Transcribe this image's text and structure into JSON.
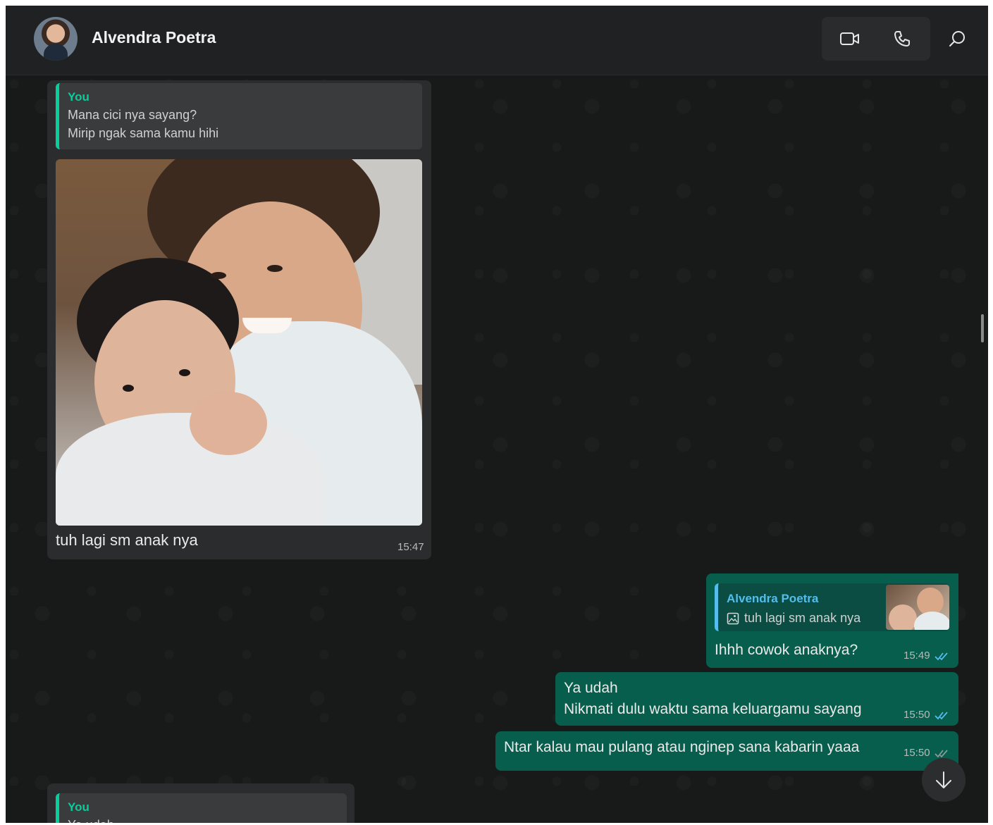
{
  "header": {
    "contact_name": "Alvendra Poetra",
    "icons": {
      "avatar": "contact-avatar",
      "video": "video-call-icon",
      "voice": "voice-call-icon",
      "search": "search-icon"
    }
  },
  "messages": {
    "m1": {
      "quote_author": "You",
      "quote_line1": "Mana cici nya sayang?",
      "quote_line2": "Mirip ngak sama kamu hihi",
      "caption": "tuh lagi sm anak nya",
      "time": "15:47",
      "attachment": "photo-woman-with-baby"
    },
    "m2": {
      "quote_author": "Alvendra Poetra",
      "quote_text": "tuh lagi sm anak nya",
      "quote_icon": "image-icon",
      "text": "Ihhh cowok anaknya?",
      "time": "15:49"
    },
    "m3": {
      "line1": "Ya udah",
      "line2": "Nikmati dulu waktu sama keluargamu sayang",
      "time": "15:50"
    },
    "m4": {
      "text": "Ntar kalau mau pulang atau nginep sana kabarin yaaa",
      "time": "15:50"
    },
    "m5": {
      "quote_author": "You",
      "quote_text": "Ya udah"
    }
  },
  "colors": {
    "accent_green": "#06cf9c",
    "outgoing_bubble": "#075e4d",
    "read_tick": "#53bdeb"
  }
}
